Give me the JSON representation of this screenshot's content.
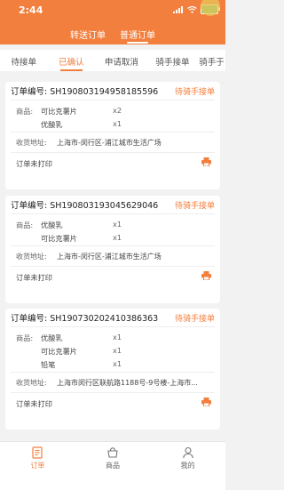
{
  "status_bar": {
    "time": "2:44"
  },
  "mode_tabs": [
    {
      "label": "转送订单",
      "active": false
    },
    {
      "label": "普通订单",
      "active": true
    }
  ],
  "status_tabs": [
    {
      "label": "待接单",
      "active": false
    },
    {
      "label": "已确认",
      "active": true
    },
    {
      "label": "申请取消",
      "active": false
    },
    {
      "label": "骑手接单",
      "active": false
    },
    {
      "label": "骑手于",
      "active": false
    }
  ],
  "common": {
    "order_no_label": "订单编号:",
    "goods_label": "商品:",
    "address_label": "收货地址:",
    "print_status": "订单未打印"
  },
  "orders": [
    {
      "order_no": "SH190803194958185596",
      "status": "待骑手接单",
      "items": [
        {
          "name": "可比克薯片",
          "qty": "x2"
        },
        {
          "name": "优酸乳",
          "qty": "x1"
        }
      ],
      "address": "上海市-闵行区-浦江城市生活广场"
    },
    {
      "order_no": "SH190803193045629046",
      "status": "待骑手接单",
      "items": [
        {
          "name": "优酸乳",
          "qty": "x1"
        },
        {
          "name": "可比克薯片",
          "qty": "x1"
        }
      ],
      "address": "上海市-闵行区-浦江城市生活广场"
    },
    {
      "order_no": "SH190730202410386363",
      "status": "待骑手接单",
      "items": [
        {
          "name": "优酸乳",
          "qty": "x1"
        },
        {
          "name": "可比克薯片",
          "qty": "x1"
        },
        {
          "name": "铅笔",
          "qty": "x1"
        }
      ],
      "address": "上海市闵行区联航路1188号-9号楼-上海市..."
    }
  ],
  "tabbar": [
    {
      "label": "订单",
      "icon": "order-icon",
      "active": true
    },
    {
      "label": "商品",
      "icon": "goods-icon",
      "active": false
    },
    {
      "label": "我的",
      "icon": "profile-icon",
      "active": false
    }
  ],
  "colors": {
    "accent": "#f27f3d",
    "background": "#f2f2f2"
  }
}
